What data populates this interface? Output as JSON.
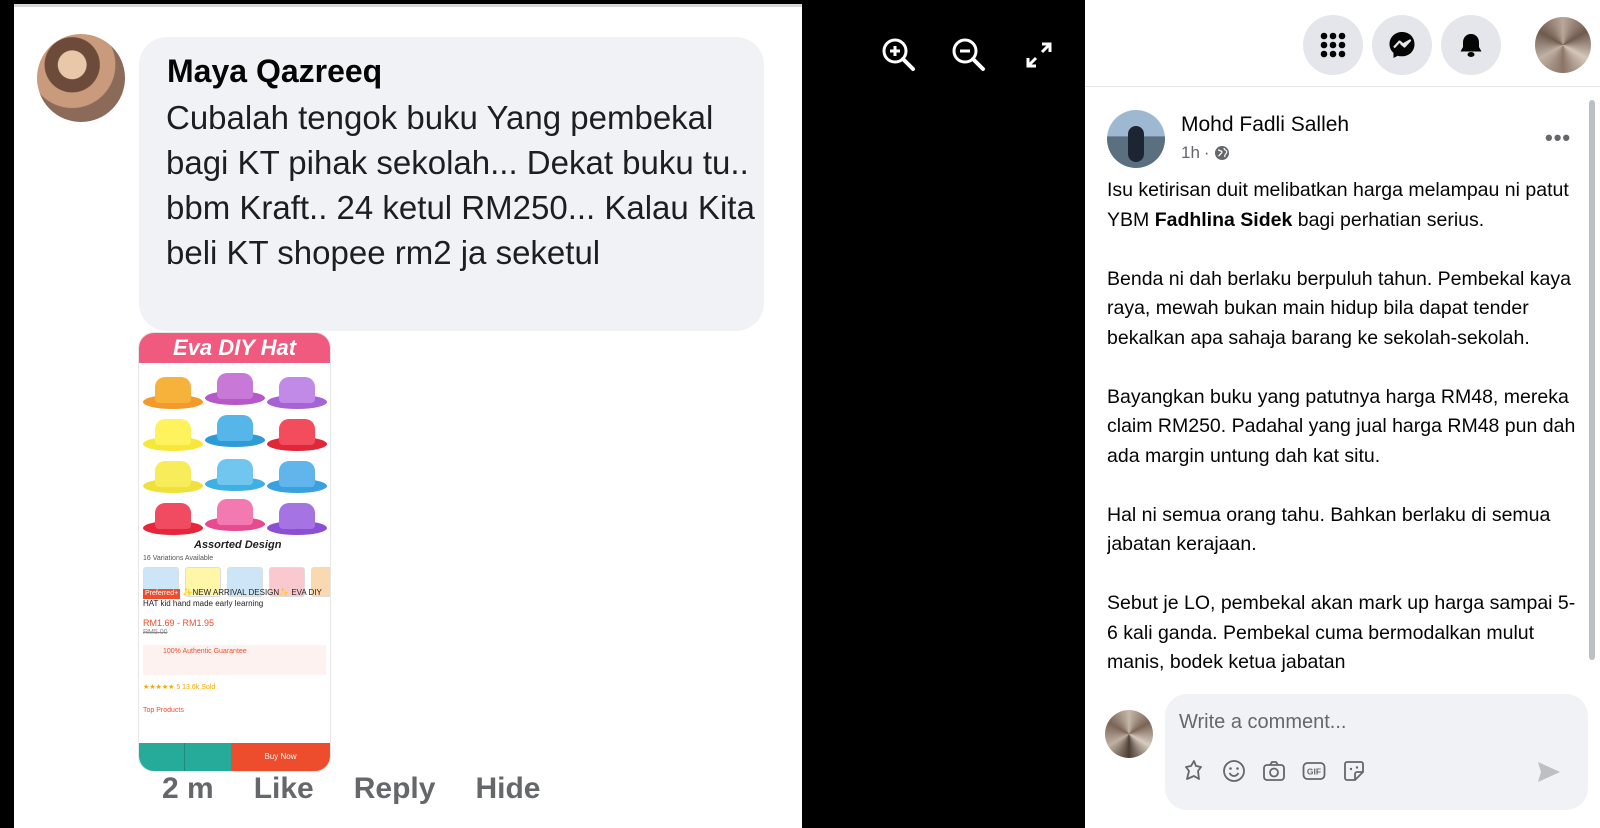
{
  "comment": {
    "author": "Maya Qazreeq",
    "text": "Cubalah tengok buku Yang pembekal bagi KT pihak sekolah... Dekat buku tu.. bbm Kraft.. 24 ketul RM250... Kalau Kita beli KT shopee rm2 ja seketul",
    "time": "2 m",
    "like": "Like",
    "reply": "Reply",
    "hide": "Hide",
    "screenshot": {
      "banner": "Eva DIY Hat",
      "caption": "Assorted Design",
      "variations": "16 Variations Available",
      "tag": "Preferred+",
      "title": "✨NEW ARRIVAL DESIGN✨ EVA DIY HAT kid hand made early learning",
      "price": "RM1.69 - RM1.95",
      "old_price": "RM5.00",
      "guarantee": "100% Authentic Guarantee",
      "rating": "★★★★★ 5   13.6k Sold",
      "top_products": "Top Products",
      "buy": "Buy Now"
    }
  },
  "viewer": {
    "zoom_in_icon": "zoom-in-icon",
    "zoom_out_icon": "zoom-out-icon",
    "fullscreen_icon": "fullscreen-icon"
  },
  "post": {
    "author": "Mohd Fadli Salleh",
    "time": "1h",
    "paragraphs": [
      {
        "before": "Isu ketirisan duit melibatkan harga melampau ni patut YBM ",
        "bold": "Fadhlina Sidek",
        "after": " bagi perhatian serius."
      },
      {
        "before": "Benda ni dah berlaku berpuluh tahun. Pembekal kaya raya, mewah bukan main hidup bila dapat tender bekalkan apa sahaja barang ke sekolah-sekolah.",
        "bold": "",
        "after": ""
      },
      {
        "before": "Bayangkan buku yang patutnya harga RM48, mereka claim RM250. Padahal yang jual harga RM48 pun dah ada margin untung dah kat situ.",
        "bold": "",
        "after": ""
      },
      {
        "before": "Hal ni semua orang tahu. Bahkan berlaku di semua jabatan kerajaan.",
        "bold": "",
        "after": ""
      },
      {
        "before": "Sebut je LO, pembekal akan mark up harga sampai 5-6 kali ganda. Pembekal cuma bermodalkan mulut manis, bodek ketua jabatan",
        "bold": "",
        "after": ""
      }
    ]
  },
  "composer": {
    "placeholder": "Write a comment..."
  },
  "colors": {
    "fb_grey": "#e4e6eb",
    "bubble_grey": "#f0f2f5",
    "secondary_text": "#65676b"
  }
}
